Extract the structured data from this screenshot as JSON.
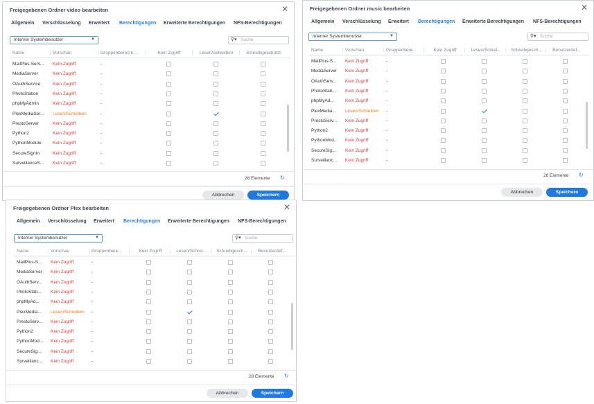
{
  "tabs": [
    "Allgemein",
    "Verschlüsselung",
    "Erweitert",
    "Berechtigungen",
    "Erweiterte Berechtigungen",
    "NFS-Berechtigungen"
  ],
  "active_tab": "Berechtigungen",
  "user_select": "Interner Systembenutzer",
  "search_placeholder": "Suche",
  "count_label": "28 Elemente",
  "cancel_label": "Abbrechen",
  "save_label": "Speichern",
  "colors": {
    "accent": "#2a7fd9",
    "no_access": "#e53935",
    "readwrite": "#f07c1f"
  },
  "dialogs": [
    {
      "title": "Freigegebenen Ordner video bearbeiten",
      "columns": [
        "Name",
        "Vorschau",
        "Gruppenberecht...",
        "Kein Zugriff",
        "Lesen/Schreiben",
        "Schreibgeschützt"
      ],
      "rows": [
        {
          "name": "MailPlus-Serv...",
          "preview": "Kein Zugriff",
          "group": "-",
          "checked": null
        },
        {
          "name": "MediaServer",
          "preview": "Kein Zugriff",
          "group": "-",
          "checked": null
        },
        {
          "name": "OAuthService",
          "preview": "Kein Zugriff",
          "group": "-",
          "checked": null
        },
        {
          "name": "PhotoStation",
          "preview": "Kein Zugriff",
          "group": "-",
          "checked": null
        },
        {
          "name": "phpMyAdmin",
          "preview": "Kein Zugriff",
          "group": "-",
          "checked": null
        },
        {
          "name": "PlexMediaSer...",
          "preview": "Lesen/Schreiben",
          "group": "-",
          "checked": 1
        },
        {
          "name": "PrestoServer",
          "preview": "Kein Zugriff",
          "group": "-",
          "checked": null
        },
        {
          "name": "Python2",
          "preview": "Kein Zugriff",
          "group": "-",
          "checked": null
        },
        {
          "name": "PythonModule",
          "preview": "Kein Zugriff",
          "group": "-",
          "checked": null
        },
        {
          "name": "SecureSignIn",
          "preview": "Kein Zugriff",
          "group": "-",
          "checked": null
        },
        {
          "name": "SurveillanceS...",
          "preview": "Kein Zugriff",
          "group": "-",
          "checked": null
        }
      ]
    },
    {
      "title": "Freigegebenen Ordner music bearbeiten",
      "columns": [
        "Name",
        "Vorschau",
        "Gruppenbere...",
        "Kein Zugriff",
        "Lesen/Schrei...",
        "Schreibgesch...",
        "Benutzerdef..."
      ],
      "rows": [
        {
          "name": "MailPlus-S...",
          "preview": "Kein Zugriff",
          "group": "-",
          "checked": null
        },
        {
          "name": "MediaServer",
          "preview": "Kein Zugriff",
          "group": "-",
          "checked": null
        },
        {
          "name": "OAuthServ...",
          "preview": "Kein Zugriff",
          "group": "-",
          "checked": null
        },
        {
          "name": "PhotoStati...",
          "preview": "Kein Zugriff",
          "group": "-",
          "checked": null
        },
        {
          "name": "phpMyAd...",
          "preview": "Kein Zugriff",
          "group": "-",
          "checked": null
        },
        {
          "name": "PlexMedia...",
          "preview": "Lesen/Schreiben",
          "group": "-",
          "checked": 1
        },
        {
          "name": "PrestoServ...",
          "preview": "Kein Zugriff",
          "group": "-",
          "checked": null
        },
        {
          "name": "Python2",
          "preview": "Kein Zugriff",
          "group": "-",
          "checked": null
        },
        {
          "name": "PythonMod...",
          "preview": "Kein Zugriff",
          "group": "-",
          "checked": null
        },
        {
          "name": "SecureSig...",
          "preview": "Kein Zugriff",
          "group": "-",
          "checked": null
        },
        {
          "name": "Surveillanc...",
          "preview": "Kein Zugriff",
          "group": "-",
          "checked": null
        }
      ]
    },
    {
      "title": "Freigegebenen Ordner Plex bearbeiten",
      "columns": [
        "Name",
        "Vorschau",
        "Gruppenbere...",
        "Kein Zugriff",
        "Lesen/Schrei...",
        "Schreibgesch...",
        "Benutzerdef..."
      ],
      "rows": [
        {
          "name": "MailPlus-S...",
          "preview": "Kein Zugriff",
          "group": "-",
          "checked": null
        },
        {
          "name": "MediaServer",
          "preview": "Kein Zugriff",
          "group": "-",
          "checked": null
        },
        {
          "name": "OAuthServ...",
          "preview": "Kein Zugriff",
          "group": "-",
          "checked": null
        },
        {
          "name": "PhotoStati...",
          "preview": "Kein Zugriff",
          "group": "-",
          "checked": null
        },
        {
          "name": "phpMyAd...",
          "preview": "Kein Zugriff",
          "group": "-",
          "checked": null
        },
        {
          "name": "PlexMedia...",
          "preview": "Lesen/Schreiben",
          "group": "-",
          "checked": 1
        },
        {
          "name": "PrestoServ...",
          "preview": "Kein Zugriff",
          "group": "-",
          "checked": null
        },
        {
          "name": "Python2",
          "preview": "Kein Zugriff",
          "group": "-",
          "checked": null
        },
        {
          "name": "PythonMod...",
          "preview": "Kein Zugriff",
          "group": "-",
          "checked": null
        },
        {
          "name": "SecureSig...",
          "preview": "Kein Zugriff",
          "group": "-",
          "checked": null
        },
        {
          "name": "Surveillanc...",
          "preview": "Kein Zugriff",
          "group": "-",
          "checked": null
        }
      ]
    }
  ]
}
